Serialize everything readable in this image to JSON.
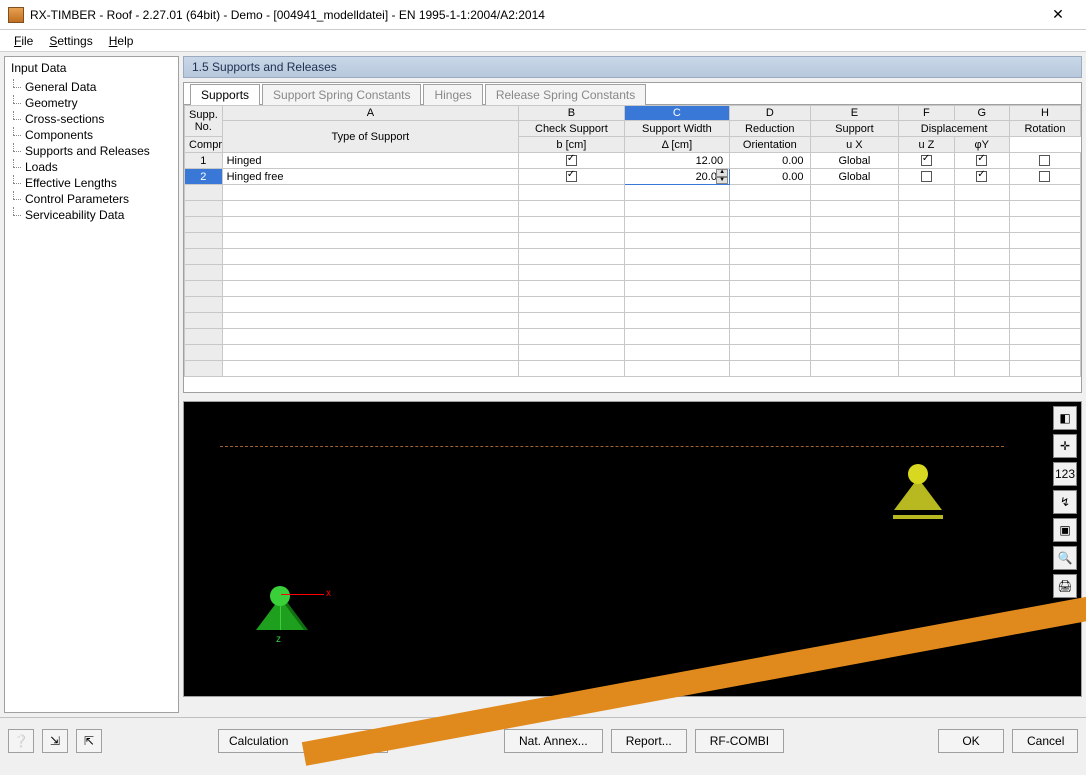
{
  "window": {
    "title": "RX-TIMBER - Roof - 2.27.01 (64bit) -  Demo - [004941_modelldatei] - EN 1995-1-1:2004/A2:2014",
    "close": "✕"
  },
  "menu": {
    "file": "File",
    "settings": "Settings",
    "help": "Help"
  },
  "tree": {
    "root": "Input Data",
    "items": [
      "General Data",
      "Geometry",
      "Cross-sections",
      "Components",
      "Supports and Releases",
      "Loads",
      "Effective Lengths",
      "Control Parameters",
      "Serviceability Data"
    ]
  },
  "section": {
    "title": "1.5 Supports and Releases"
  },
  "tabs": [
    "Supports",
    "Support Spring Constants",
    "Hinges",
    "Release Spring Constants"
  ],
  "grid": {
    "cols_letters": [
      "A",
      "B",
      "C",
      "D",
      "E",
      "F",
      "G",
      "H"
    ],
    "rowhdr": [
      "Supp.",
      "No."
    ],
    "colH": {
      "A": "Type of Support",
      "B1": "Check Support",
      "B2": "Compression",
      "C1": "Support Width",
      "C2": "b [cm]",
      "D1": "Reduction",
      "D2": "Δ [cm]",
      "E1": "Support",
      "E2": "Orientation",
      "FG": "Displacement",
      "F2": "u X",
      "G2": "u Z",
      "H1": "Rotation",
      "H2": "φY"
    },
    "rows": [
      {
        "no": "1",
        "type": "Hinged",
        "chk": true,
        "width": "12.00",
        "red": "0.00",
        "orient": "Global",
        "ux": true,
        "uz": true,
        "rot": false
      },
      {
        "no": "2",
        "type": "Hinged free",
        "chk": true,
        "width": "20.00",
        "red": "0.00",
        "orient": "Global",
        "ux": false,
        "uz": true,
        "rot": false
      }
    ]
  },
  "viz": {
    "axis_x": "x",
    "axis_z": "z"
  },
  "footer": {
    "calc": "Calculation",
    "nat": "Nat. Annex...",
    "report": "Report...",
    "rf": "RF-COMBI",
    "ok": "OK",
    "cancel": "Cancel"
  }
}
